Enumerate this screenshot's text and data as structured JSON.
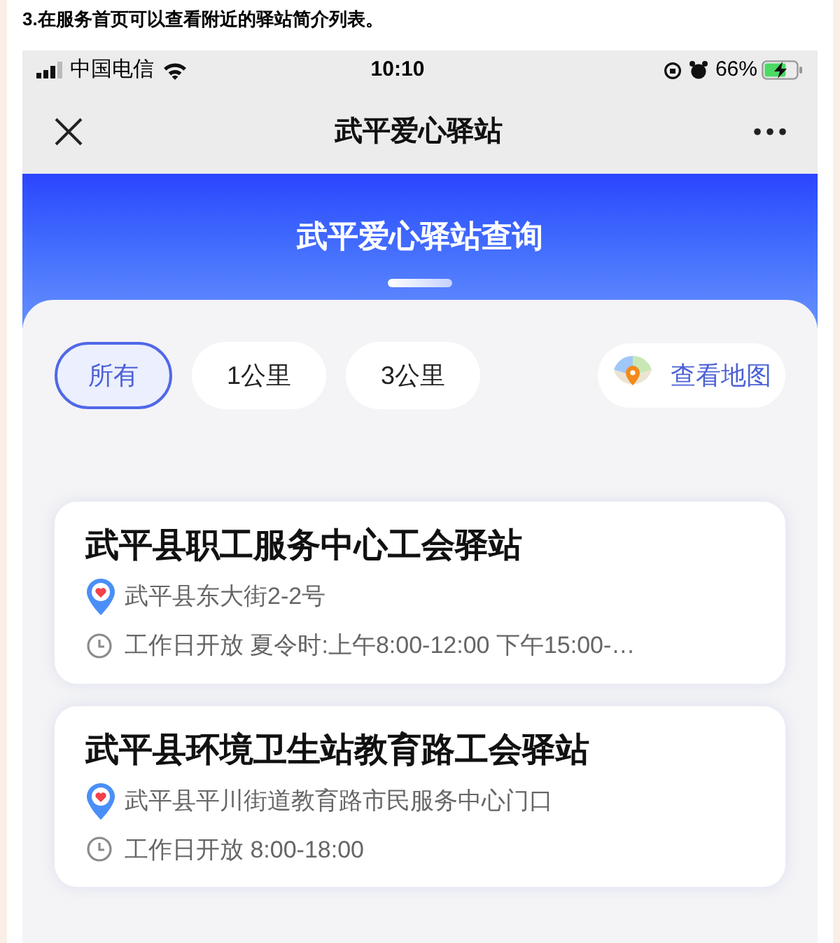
{
  "caption": "3.在服务首页可以查看附近的驿站简介列表。",
  "status_bar": {
    "carrier": "中国电信",
    "time": "10:10",
    "battery": "66%"
  },
  "nav": {
    "title": "武平爱心驿站"
  },
  "header": {
    "title": "武平爱心驿站查询"
  },
  "filters": [
    {
      "label": "所有",
      "selected": true
    },
    {
      "label": "1公里",
      "selected": false
    },
    {
      "label": "3公里",
      "selected": false
    }
  ],
  "map_button": {
    "label": "查看地图"
  },
  "stations": [
    {
      "name": "武平县职工服务中心工会驿站",
      "address": "武平县东大街2-2号",
      "hours": "工作日开放 夏令时:上午8:00-12:00 下午15:00-…"
    },
    {
      "name": "武平县环境卫生站教育路工会驿站",
      "address": "武平县平川街道教育路市民服务中心门口",
      "hours": "工作日开放 8:00-18:00"
    }
  ]
}
